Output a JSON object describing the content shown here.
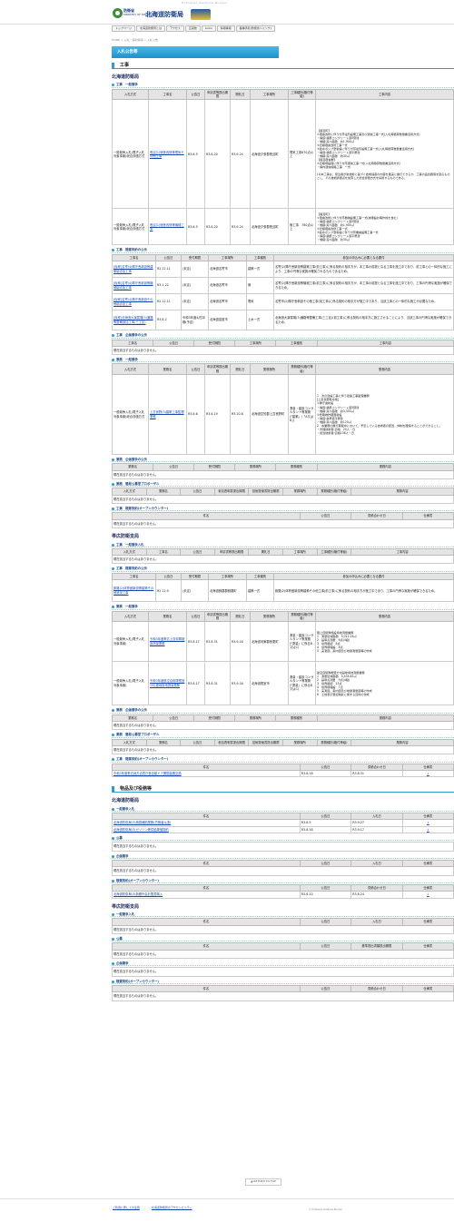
{
  "header": {
    "logo_main": "防衛省",
    "logo_sub": "MINISTRY OF DEFENSE",
    "site_name": "北海道防衛局",
    "banner": "Hokkaido Defense Bureau"
  },
  "nav": [
    "トップページ",
    "北海道防衛局とは",
    "アクセス",
    "広報誌",
    "Links",
    "情報等報",
    "各種手続(防衛省へリンク)"
  ],
  "breadcrumb": "HOME > 入札・契約情報 > 入札公告",
  "page_title": "入札公告等",
  "none": "現在該当するものはありません。",
  "h": {
    "koji": "工事",
    "bukken": "物品及び役務等"
  },
  "org": {
    "hq": "北海道防衛局",
    "obihiro": "帯広防衛支局"
  },
  "sub": {
    "k_ippan": "工事　一般競争",
    "k_zuii": "工事　随意契約の公示",
    "k_kikaku": "工事　企画競争の公示",
    "g_ippan": "業務　一般競争",
    "g_kikaku": "業務　企画競争の公示",
    "g_proposal": "業務　簡易公募型プロポーザル",
    "k_open": "工事　随意契約(オープンカウンター)",
    "ob_ippan": "工事　一般競争入札",
    "b_ippan": "一般競争入札",
    "b_koubo": "公募",
    "b_kikaku": "企画競争",
    "b_open": "随意契約(オープンカウンター)"
  },
  "cols": {
    "ippan": [
      "入札方式",
      "工事名",
      "公告日",
      "申請書等提出期限",
      "開札日",
      "工事場所",
      "工事種別(格付等級)",
      "工事内容"
    ],
    "zuii": [
      "工事名",
      "公告日",
      "受付期間",
      "工事場所",
      "工事種別",
      "参加の申込みに必要となる要件"
    ],
    "kikaku": [
      "工事名",
      "公告日",
      "受付期間",
      "工事場所",
      "工事種別",
      "工事内容"
    ],
    "gippan": [
      "入札方式",
      "業務名",
      "公告日",
      "申請書等提出期限",
      "開札日",
      "業務場所",
      "業務種別(格付等級)",
      "業務内容"
    ],
    "gkikaku": [
      "業務名",
      "公告日",
      "受付期間",
      "業務場所",
      "業務種別",
      "業務内容"
    ],
    "gprop": [
      "入札方式",
      "業務名",
      "公告日",
      "参加表明書提出期限",
      "技術提案書提出期限",
      "業務場所",
      "業務種別(格付等級)",
      "業務内容"
    ],
    "open": [
      "件名",
      "公告日",
      "見積合わせ日",
      "仕様書"
    ],
    "bippan": [
      "件名",
      "公告日",
      "入札日",
      "仕様書"
    ],
    "bkikaku": [
      "件名",
      "公告日",
      "基準提出書類提出期限",
      "仕様書"
    ]
  },
  "hq_koji": [
    {
      "method": "一般競争入札(電子入札対象事案)総合評価方式",
      "name": "長沼(1)宿舎改修等電気その他工事",
      "notice": "R3.8.5",
      "deadline": "R3.8.20",
      "open": "R3.9.24",
      "place": "北海道夕張郡長沼町",
      "type": "電気工事870点以上",
      "content": "【長沼町】\n①宿舎改修に伴う付帯電気設備工事及び通信工事一式(入札時積算数量書活用方式)\n・構造:鉄筋コンクリート造5階建\n・規模:延べ面積　約1,900㎡\n②旧棟宿舎改修工事一式\n③給水ポンプ室新設に伴う付帯電気設備工事一式(入札時積算数量書活用方式)\n・構造:鉄筋コンクリート造平屋建\n・規模:延べ面積　約30㎡\n【長沼宿舎群】\n①旧棟増設棟に伴う付帯通信工事一式(入札時積算数量書活用方式)\n・構内通信線路工事　一式\n\n(1)本工事は、受注者が新技術に基づく技術提案の内容を確実に遂行できるか、工事の品質確保を図るものとし、その技術評価点を加算した総合評価方式を採用するものである。"
    },
    {
      "method": "一般競争入札(電子入札対象事案)総合評価方式",
      "name": "長沼(1)宿舎改修等機械工事",
      "notice": "R3.8.5",
      "deadline": "R3.8.20",
      "open": "R3.9.24",
      "place": "北海道夕張郡長沼町",
      "type": "管工事　780点以上",
      "content": "【長沼町】\n①宿舎改修に伴う付帯機械設備工事一式(詳細設計等作成を含む)\n・構造:鉄筋コンクリート造5階建\n・規模:延べ面積　約1,900㎡\n②旧棟宿舎改修工事一式\n③給水ポンプ室新設に伴う付帯機械設備工事一式\n・構造:鉄筋コンクリート造平屋建\n・規模:延べ面積　約30㎡"
    }
  ],
  "hq_zuii": [
    {
      "name": "[仮称]名寄(4)隊庁舎新設等建築組合加工事",
      "notice": "R2.12.11",
      "period": "(未定)",
      "place": "北海道名寄市",
      "type": "建築一式",
      "req": "名寄(2)隊庁舎新設等建築工事(前工事)に係る契約の相手方が、本工事の前提となる工事を施工中であり、前工事との一体的な施工により、工事の円滑な実施が確保されるものであるため。"
    },
    {
      "name": "[仮称]名寄(4)隊庁舎新設等機械組合加工事",
      "notice": "R3.1.22",
      "period": "(未定)",
      "place": "北海道名寄市",
      "type": "管",
      "req": "名寄(2)隊庁舎新設等機械工事(前工事)に係る契約の相手方が、本工事の前提となる工事を施工中であり、工事の円滑な実施が確保できるため。"
    },
    {
      "name": "[仮称]名寄(4)隊庁舎新設その他組合加工事",
      "notice": "R2.12.11",
      "period": "(未定)",
      "place": "北海道名寄市",
      "type": "電気",
      "req": "名寄市(2)隊庁舎新設その他工事(前工事)に係る契約の相手方が施工中であり、当該工事との一体的な施工が必要なため。"
    },
    {
      "name": "[仮称]北海道大演習場(3)通路等整備追加工事(三工区)",
      "notice": "R3.8.2",
      "period": "令和3年度4/四半期(予定)",
      "place": "北海道恵庭市",
      "type": "土木一式",
      "req": "北海道大演習場(3)通路等整備工事(三工区)(前工事)に係る契約の相手方に施工させることにより、当該工事の円滑な実施が確保できるため。"
    }
  ],
  "hq_gyomu": {
    "method": "一般競争入札(電子入札対象事案)総合評価方式",
    "name": "上富良野(3)建築工事監理業務",
    "notice": "R3.8.6",
    "deadline": "R3.8.19",
    "open": "R3.10.8",
    "place": "北海道空知郡上富良野町",
    "type": "測量・建設コンサルタント等業務(「建築」/「A又はB」)",
    "content": "1　次の建設工事に伴う建築工事監理業務\n[上富良野駐屯地]\n①隊庁舎新設\n・構造:鉄筋コンクリート造5階建\n・規模:延べ面積　約3,500㎡\n②危険物貯蔵庫新設\n・構造:鉄骨造平屋建\n・規模:延べ面積　約120㎡\n2　本業務の履行期間中において、予定している技術者の配置、体制を確保することができること。\n・管理技術者:資格　20人・日\n・担当技術者:資格138人・日"
  },
  "ob_zuii": {
    "name": "釧路(2)体育館新設等建築その他追加工事",
    "notice": "R2.12.9",
    "period": "(未定)",
    "place": "北海道釧路郡釧路町",
    "type": "建築一式",
    "req": "釧路(2)体育館新設等建築その他工事(前工事)に係る契約の相手方が施工中であり、工事の円滑な実施が確保できるため。"
  },
  "ob_gyomu": [
    {
      "method": "一般競争入札(電子入札対象事案)",
      "name": "令和3年度帯広上自衛隊施設測量業務",
      "notice": "R3.8.17",
      "deadline": "R3.8.31",
      "open": "R3.9.16",
      "place": "北海道河東郡音更町",
      "type": "測量・建設コンサルタント等業務(「測量」に係るB又はC)",
      "content": "陸上自衛隊施設用地測量業務\n1　測量区域面積　5,012.16㎡\n2　基準点測量　6点(4級)\n3　境界確認　6点\n4　境界標埋設　6点\n5　実測図、案内図及び地積測量図等の作成"
    },
    {
      "method": "一般競争入札(電子入札対象事案)",
      "name": "令和3年度航空自衛隊根室分屯基地用地測量業務",
      "notice": "R3.8.17",
      "deadline": "R3.8.31",
      "open": "R3.9.16",
      "place": "北海道根室市",
      "type": "測量・建設コンサルタント等業務(「測量」に係るB又はC)",
      "content": "航空自衛隊根室分屯基地用地測量業務\n1　測量区域面積　5,434.82㎡\n2　基準点測量　9点(4級)\n3　境界確認　13点\n4　境界標埋設　7点\n5　実測図、案内図及び地積測量図等の作成\n6　土地表示登記嘱託に関する資料の作成"
    }
  ],
  "ob_open": {
    "name": "令和3年度帯広地方合同庁舎自動ドア開閉装置交換",
    "notice": "R3.8.18",
    "date": "R3.8.31",
    "spec": "↓"
  },
  "b_hq": [
    {
      "name": "北海道防衛局(3)積算補助業務(労働者派遣)",
      "notice": "R3.8.5",
      "bid": "R3.9.27",
      "spec": "↓"
    },
    {
      "name": "北海道防衛局(3)ガソリン等供給単価契約",
      "notice": "R3.8.18",
      "bid": "R3.9.17",
      "spec": "↓"
    }
  ],
  "b_hq_open": {
    "name": "北海道防衛局(3)新聞外会計図書購入",
    "notice": "R3.8.10",
    "date": "R3.8.24",
    "spec": "↓"
  },
  "back": "▲ RETURN TO TOP",
  "footer": {
    "links": [
      "ご利用に際しての注意",
      "北海道防衛局のアクセシビリティ"
    ],
    "copy": "© Hokkaido Defense Bureau"
  }
}
